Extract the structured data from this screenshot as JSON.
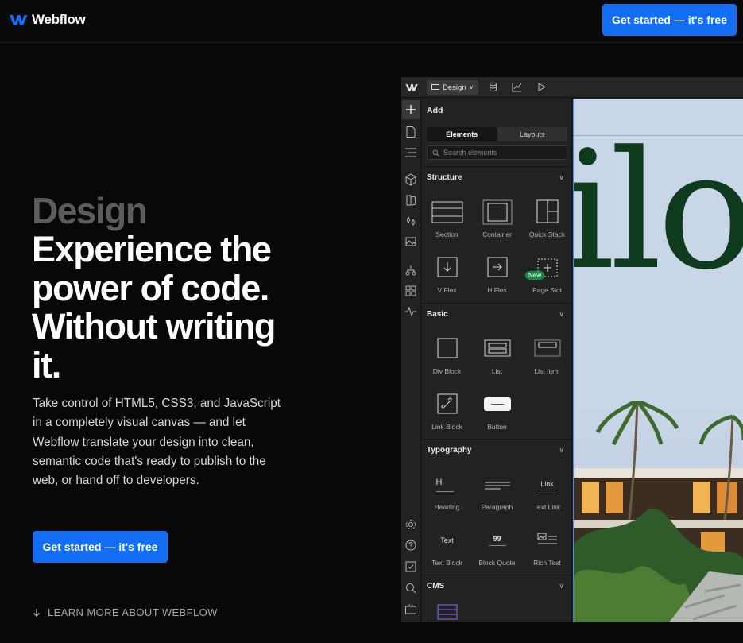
{
  "nav": {
    "brand": "Webflow",
    "cta_label": "Get started — it's free"
  },
  "hero": {
    "eyebrow": "Design",
    "headline": "Experience the power of code. Without writing it.",
    "body": "Take control of HTML5, CSS3, and JavaScript in a completely visual canvas — and let Webflow translate your design into clean, semantic code that's ready to publish to the web, or hand off to developers.",
    "cta_label": "Get started — it's free",
    "learn_more": "LEARN MORE ABOUT WEBFLOW"
  },
  "editor": {
    "mode_label": "Design",
    "panel_title": "Add",
    "tabs": [
      "Elements",
      "Layouts"
    ],
    "search_placeholder": "Search elements",
    "new_badge": "New",
    "sections": [
      {
        "title": "Structure",
        "items": [
          "Section",
          "Container",
          "Quick Stack",
          "V Flex",
          "H Flex",
          "Page Slot"
        ]
      },
      {
        "title": "Basic",
        "items": [
          "Div Block",
          "List",
          "List Item",
          "Link Block",
          "Button"
        ]
      },
      {
        "title": "Typography",
        "items": [
          "Heading",
          "Paragraph",
          "Text Link",
          "Text Block",
          "Block Quote",
          "Rich Text"
        ]
      },
      {
        "title": "CMS",
        "items": []
      }
    ],
    "glyph_text": {
      "heading": "H",
      "text_link": "Link",
      "text_block": "Text",
      "quote": "99"
    },
    "canvas_headline": "ilo"
  },
  "colors": {
    "accent": "#146ef5",
    "canvas_ink": "#0e3a1e",
    "badge": "#168a40"
  }
}
